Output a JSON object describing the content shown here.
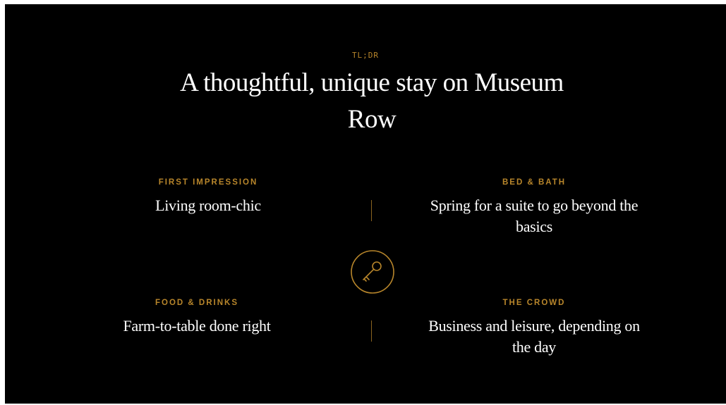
{
  "section": {
    "eyebrow": "TL;DR",
    "headline": "A thoughtful, unique stay on Museum Row"
  },
  "highlights": [
    {
      "label": "FIRST IMPRESSION",
      "value": "Living room-chic"
    },
    {
      "label": "BED & BATH",
      "value": "Spring for a suite to go beyond the basics"
    },
    {
      "label": "FOOD & DRINKS",
      "value": "Farm-to-table done right"
    },
    {
      "label": "THE CROWD",
      "value": "Business and leisure, depending on the day"
    }
  ],
  "emblem": {
    "icon": "key-icon"
  },
  "colors": {
    "background": "#000000",
    "accent": "#b8862b",
    "text": "#ffffff"
  }
}
